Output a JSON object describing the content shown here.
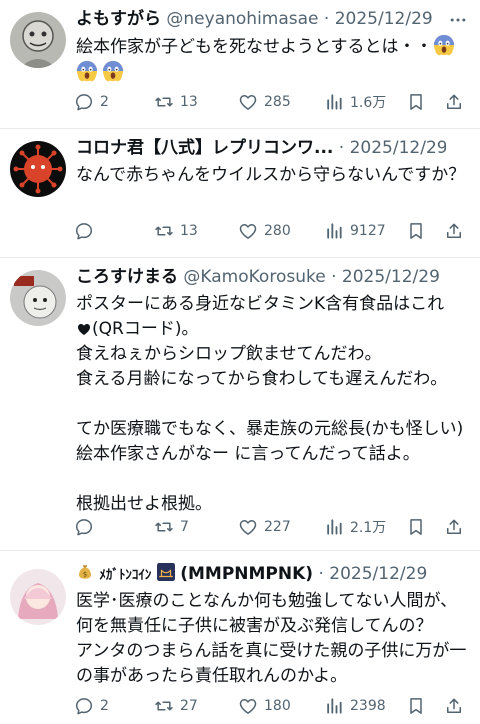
{
  "tweets": [
    {
      "name": "よもすがら",
      "handle": "@neyanohimasae",
      "sep": "·",
      "date": "2025/12/29",
      "text1": "絵本作家が子どもを死なせようとするとは・・",
      "stats": {
        "reply": "2",
        "retweet": "13",
        "like": "285",
        "views": "1.6万"
      }
    },
    {
      "name": "コロナ君【八式】レプリコンワ...",
      "sep": "·",
      "date": "2025/12/29",
      "text": "なんで赤ちゃんをウイルスから守らないんですか？",
      "stats": {
        "reply": "",
        "retweet": "13",
        "like": "280",
        "views": "9127"
      }
    },
    {
      "name": "ころすけまる",
      "handle": "@KamoKorosuke",
      "sep": "·",
      "date": "2025/12/29",
      "text1": "ポスターにある身近なビタミンK含有食品はこれ",
      "text2": "(QRコード)。\n食えねぇからシロップ飲ませてんだわ。\n食える月齢になってから食わしても遅えんだわ。\n\nてか医療職でもなく、暴走族の元総長(かも怪しい)絵本作家さんがなー に言ってんだって話よ。\n\n根拠出せよ根拠。",
      "stats": {
        "reply": "",
        "retweet": "7",
        "like": "227",
        "views": "2.1万"
      }
    },
    {
      "name_suffix": "(MMPNMPNK)",
      "name_katakana": "ﾒｶﾞﾄﾝｺｲﾝ",
      "sep": "·",
      "date": "2025/12/29",
      "text": "医学･医療のことなんか何も勉強してない人間が、何を無責任に子供に被害が及ぶ発信してんの？\nアンタのつまらん話を真に受けた親の子供に万が一の事があったら責任取れんのかよ。",
      "stats": {
        "reply": "2",
        "retweet": "27",
        "like": "180",
        "views": "2398"
      }
    }
  ],
  "icons": {
    "reply": "reply-icon",
    "retweet": "retweet-icon",
    "like": "heart-icon",
    "views": "views-icon",
    "bookmark": "bookmark-icon",
    "share": "share-icon",
    "more": "more-icon",
    "emoji": "scream-emoji"
  },
  "colors": {
    "text": "#0f1419",
    "muted": "#536471",
    "divider": "#e7e9ea"
  }
}
